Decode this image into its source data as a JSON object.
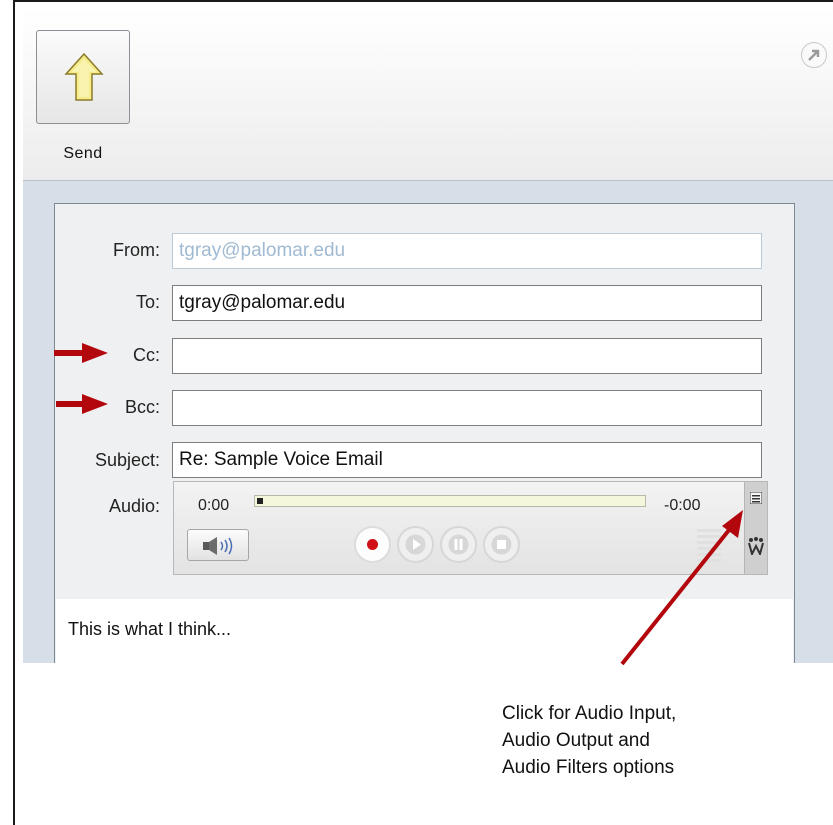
{
  "toolbar": {
    "send_label": "Send"
  },
  "form": {
    "from_label": "From:",
    "from_value": "tgray@palomar.edu",
    "to_label": "To:",
    "to_value": "tgray@palomar.edu",
    "cc_label": "Cc:",
    "cc_value": "",
    "bcc_label": "Bcc:",
    "bcc_value": "",
    "subject_label": "Subject:",
    "subject_value": "Re: Sample Voice Email",
    "audio_label": "Audio:"
  },
  "audio_player": {
    "elapsed": "0:00",
    "remaining": "-0:00",
    "progress": 0.0,
    "record_color": "#d01016"
  },
  "message": {
    "body": "This is what I think..."
  },
  "annotation": {
    "arrow_color": "#b2070d",
    "callout_lines": [
      "Click for Audio Input,",
      "Audio Output and",
      "Audio Filters options"
    ]
  },
  "icons": {
    "send": "up-arrow-icon",
    "popout": "popout-arrow-icon",
    "speaker": "speaker-icon",
    "record": "record-icon",
    "play": "play-icon",
    "pause": "pause-icon",
    "stop": "stop-icon",
    "settings": "menu-lines-icon",
    "filters": "filters-icon"
  }
}
